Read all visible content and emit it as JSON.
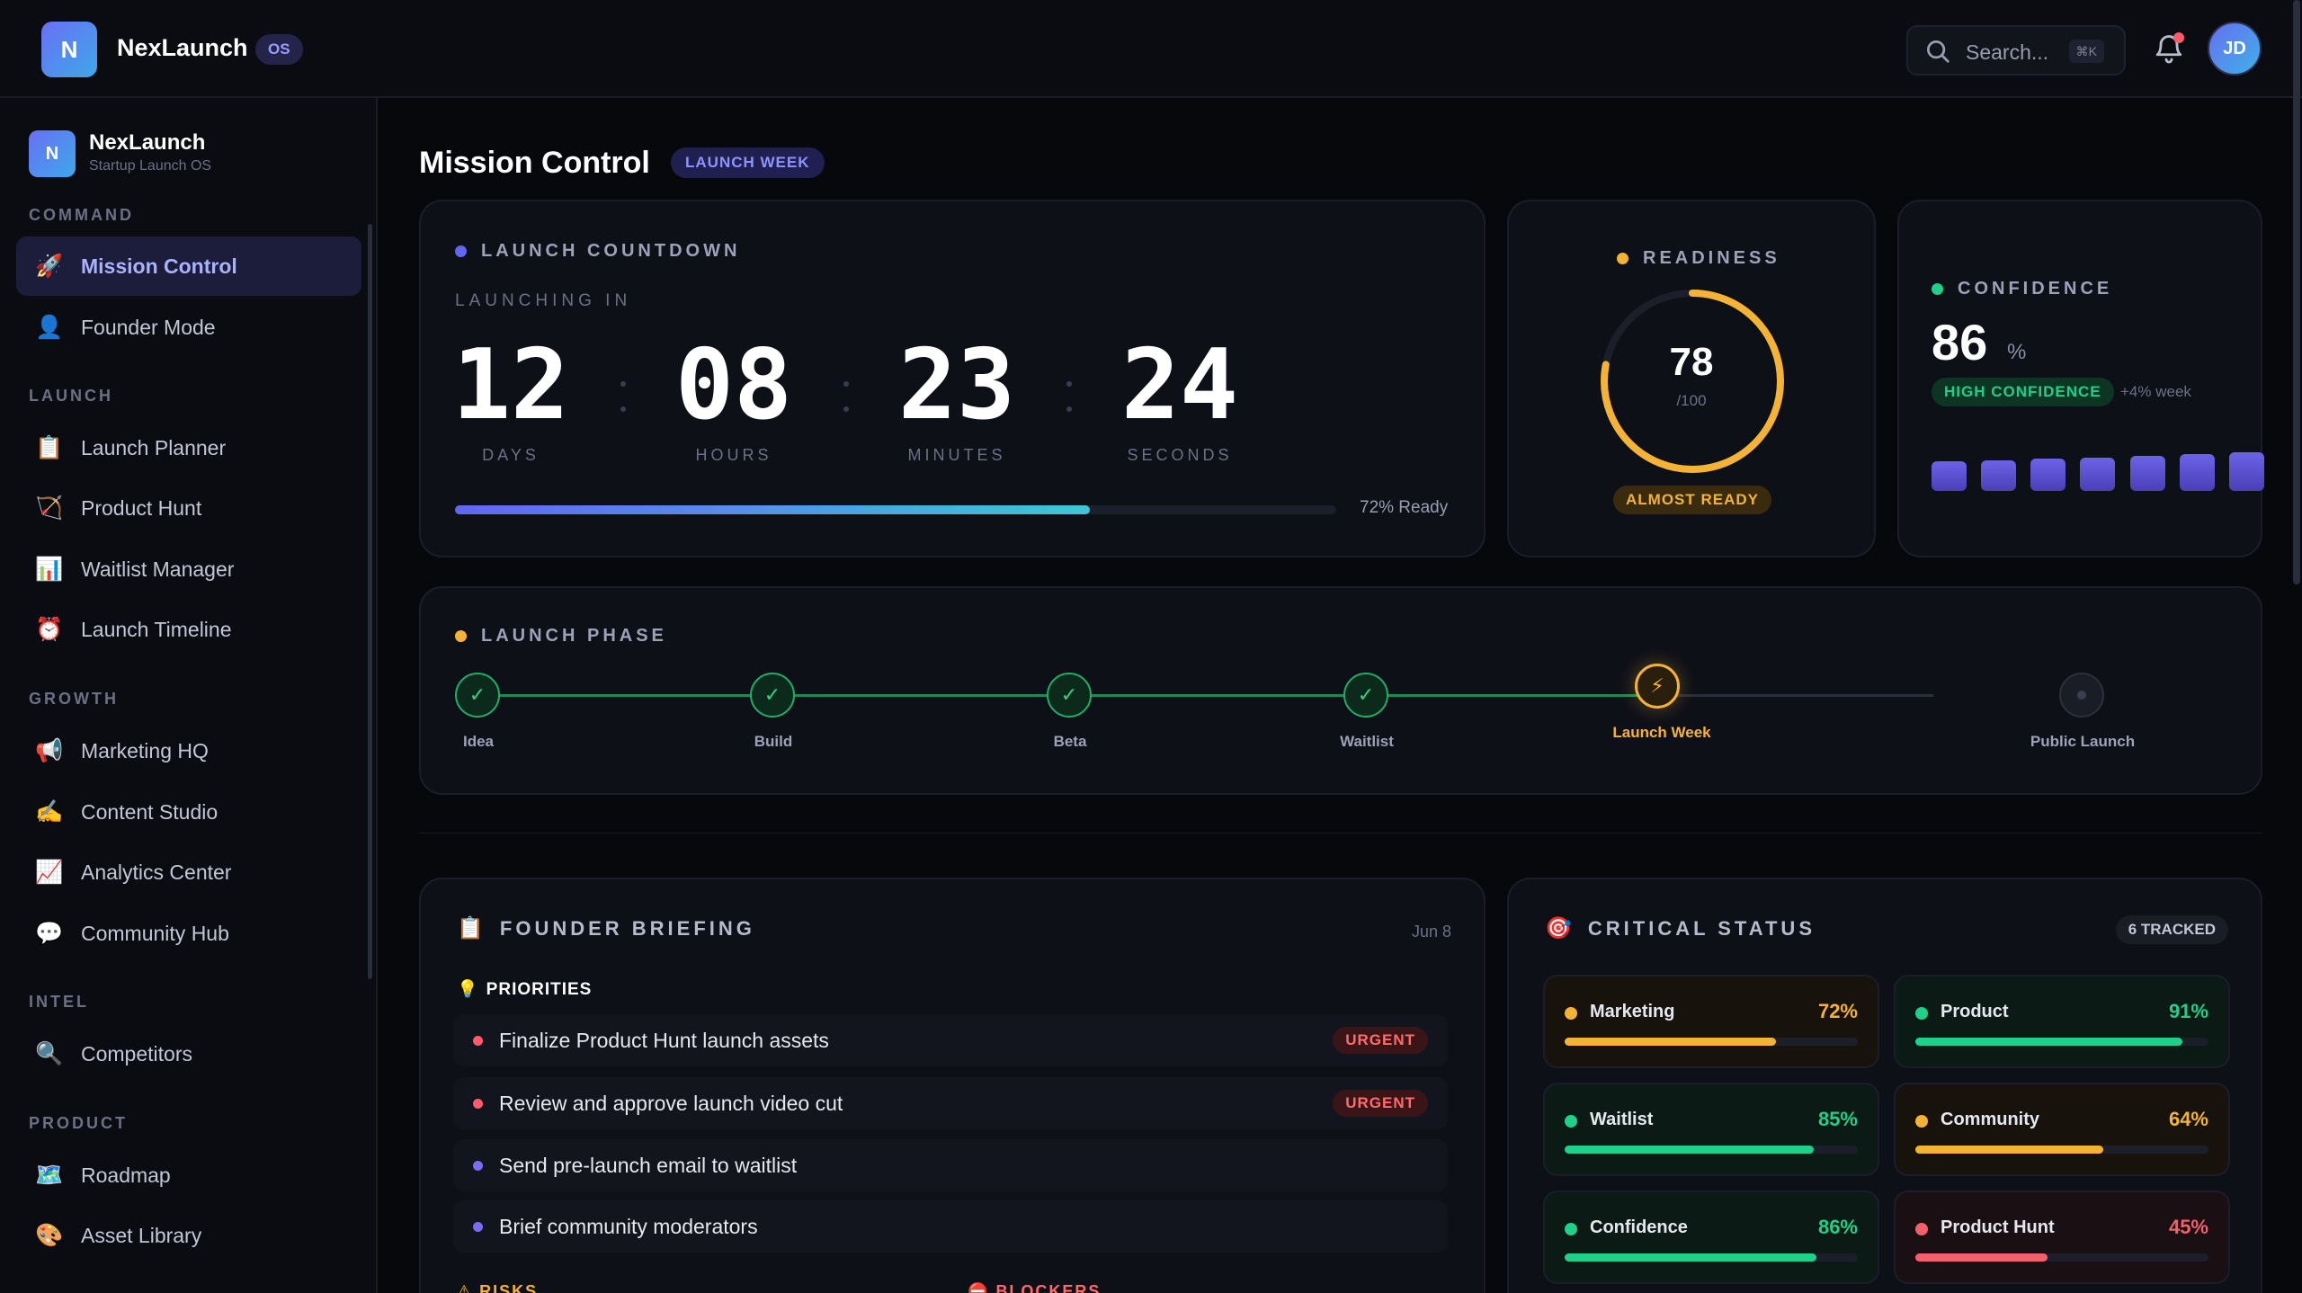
{
  "topbar": {
    "logo_letter": "N",
    "brand": "NexLaunch",
    "os_badge": "OS",
    "search_placeholder": "Search...",
    "search_shortcut": "⌘K",
    "avatar_initials": "JD"
  },
  "sidebar": {
    "logo_letter": "N",
    "name": "NexLaunch",
    "subtitle": "Startup Launch OS",
    "sections": [
      {
        "title": "COMMAND",
        "items": [
          {
            "icon": "🚀",
            "label": "Mission Control",
            "active": true
          },
          {
            "icon": "👤",
            "label": "Founder Mode"
          }
        ]
      },
      {
        "title": "LAUNCH",
        "items": [
          {
            "icon": "📋",
            "label": "Launch Planner"
          },
          {
            "icon": "🏹",
            "label": "Product Hunt"
          },
          {
            "icon": "📊",
            "label": "Waitlist Manager"
          },
          {
            "icon": "⏰",
            "label": "Launch Timeline"
          }
        ]
      },
      {
        "title": "GROWTH",
        "items": [
          {
            "icon": "📢",
            "label": "Marketing HQ"
          },
          {
            "icon": "✍️",
            "label": "Content Studio"
          },
          {
            "icon": "📈",
            "label": "Analytics Center"
          },
          {
            "icon": "💬",
            "label": "Community Hub"
          }
        ]
      },
      {
        "title": "INTEL",
        "items": [
          {
            "icon": "🔍",
            "label": "Competitors"
          }
        ]
      },
      {
        "title": "PRODUCT",
        "items": [
          {
            "icon": "🗺️",
            "label": "Roadmap"
          },
          {
            "icon": "🎨",
            "label": "Asset Library"
          }
        ]
      }
    ]
  },
  "page": {
    "title": "Mission Control",
    "badge": "LAUNCH WEEK"
  },
  "countdown": {
    "heading": "LAUNCH COUNTDOWN",
    "launching_in": "LAUNCHING IN",
    "units": [
      {
        "value": "12",
        "label": "DAYS"
      },
      {
        "value": "08",
        "label": "HOURS"
      },
      {
        "value": "23",
        "label": "MINUTES"
      },
      {
        "value": "24",
        "label": "SECONDS"
      }
    ],
    "progress": 0.72,
    "ready_text": "72% Ready"
  },
  "readiness": {
    "heading": "READINESS",
    "score": "78",
    "max": "/100",
    "fraction": 0.78,
    "status": "ALMOST READY"
  },
  "confidence": {
    "heading": "CONFIDENCE",
    "value": "86",
    "unit": "%",
    "badge": "HIGH CONFIDENCE",
    "delta": "+4% week",
    "bars": [
      0.55,
      0.57,
      0.6,
      0.62,
      0.65,
      0.68,
      0.72
    ]
  },
  "phase": {
    "heading": "LAUNCH PHASE",
    "steps": [
      {
        "label": "Idea",
        "state": "done"
      },
      {
        "label": "Build",
        "state": "done"
      },
      {
        "label": "Beta",
        "state": "done"
      },
      {
        "label": "Waitlist",
        "state": "done"
      },
      {
        "label": "Launch Week",
        "state": "current"
      },
      {
        "label": "Public Launch",
        "state": "future"
      }
    ]
  },
  "briefing": {
    "heading": "FOUNDER BRIEFING",
    "date": "Jun 8",
    "priorities_heading": "PRIORITIES",
    "tasks": [
      {
        "text": "Finalize Product Hunt launch assets",
        "tag": "URGENT",
        "color": "#ff5b6b"
      },
      {
        "text": "Review and approve launch video cut",
        "tag": "URGENT",
        "color": "#ff5b6b"
      },
      {
        "text": "Send pre-launch email to waitlist",
        "tag": "",
        "color": "#7c6cf0"
      },
      {
        "text": "Brief community moderators",
        "tag": "",
        "color": "#7c6cf0"
      }
    ],
    "risks_heading": "RISKS",
    "blockers_heading": "BLOCKERS"
  },
  "critical": {
    "heading": "CRITICAL STATUS",
    "tracked": "6 TRACKED",
    "items": [
      {
        "name": "Marketing",
        "value": "72%",
        "fraction": 0.72,
        "color": "#f5b335"
      },
      {
        "name": "Product",
        "value": "91%",
        "fraction": 0.91,
        "color": "#1fd08a"
      },
      {
        "name": "Waitlist",
        "value": "85%",
        "fraction": 0.85,
        "color": "#1fd08a"
      },
      {
        "name": "Community",
        "value": "64%",
        "fraction": 0.64,
        "color": "#f5b335"
      },
      {
        "name": "Confidence",
        "value": "86%",
        "fraction": 0.86,
        "color": "#1fd08a"
      },
      {
        "name": "Product Hunt",
        "value": "45%",
        "fraction": 0.45,
        "color": "#f2616b"
      }
    ]
  },
  "colors": {
    "accent": "#6366f1",
    "success": "#1fd08a",
    "warning": "#f5b335",
    "danger": "#ff5b6b"
  }
}
